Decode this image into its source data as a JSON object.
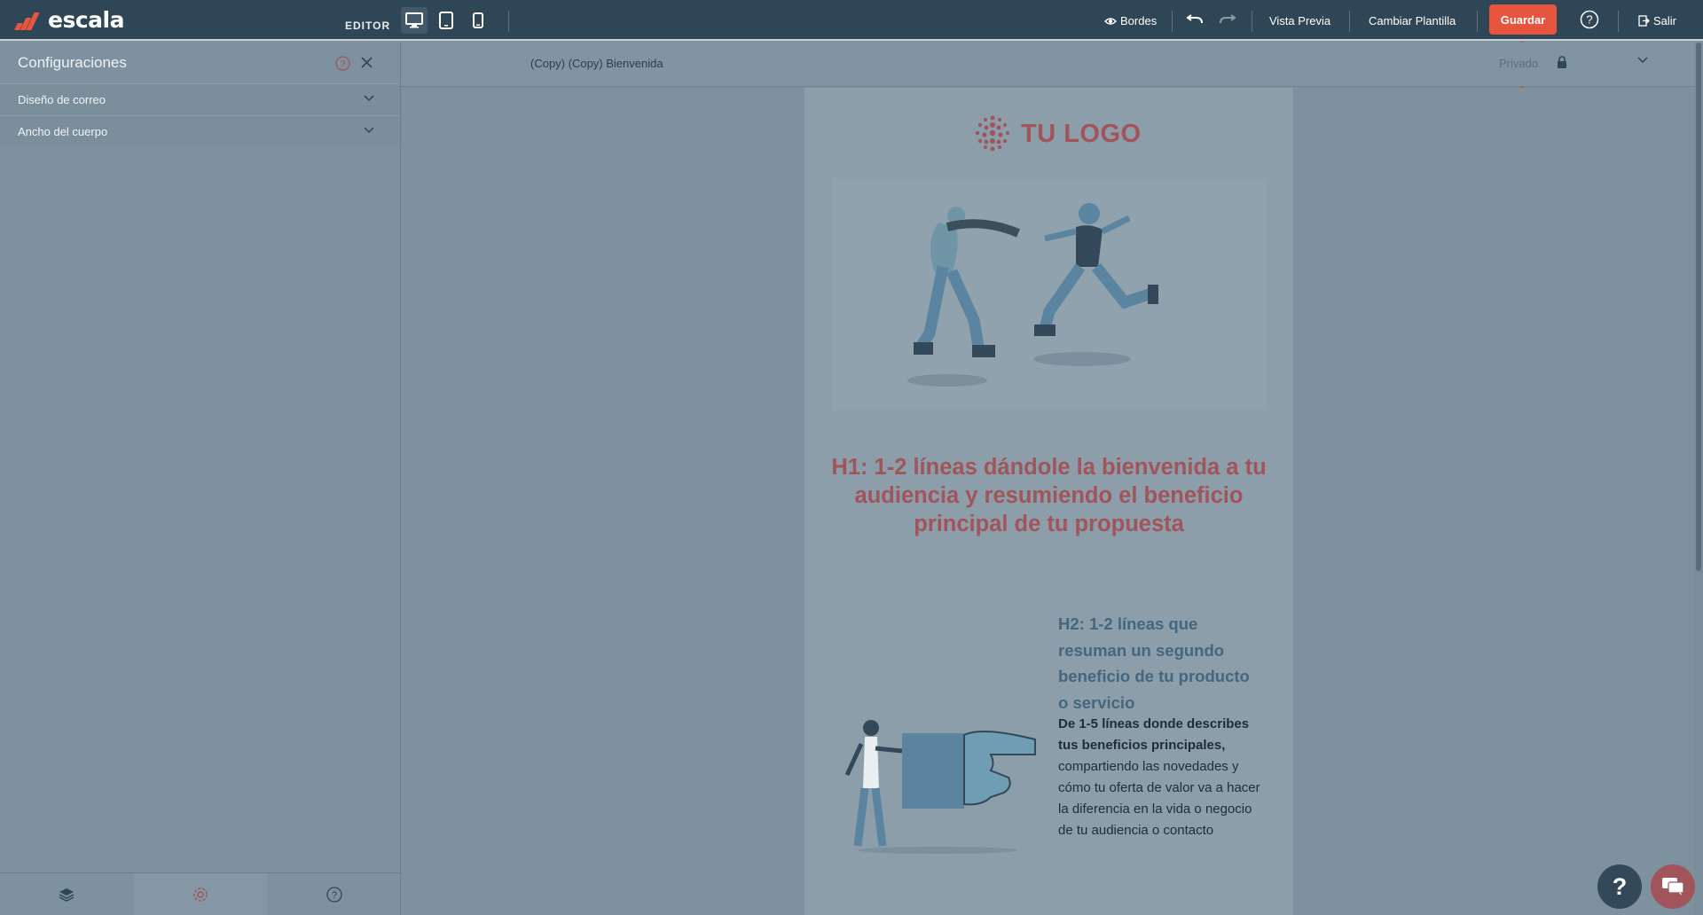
{
  "app": {
    "brand": "escala",
    "mode_label": "EDITOR"
  },
  "toolbar": {
    "devices": [
      "desktop-icon",
      "tablet-icon",
      "mobile-icon"
    ],
    "bordes_label": "Bordes",
    "vista_previa_label": "Vista Previa",
    "cambiar_plantilla_label": "Cambiar Plantilla",
    "guardar_label": "Guardar",
    "salir_label": "Salir"
  },
  "sidebar": {
    "title": "Configuraciones",
    "sections": [
      {
        "label": "Diseño de correo"
      },
      {
        "label": "Ancho del cuerpo"
      }
    ]
  },
  "canvas": {
    "template_name": "(Copy) (Copy) Bienvenida",
    "visibility_label": "Privado"
  },
  "email": {
    "logo_text": "TU LOGO",
    "h1": "H1: 1-2 líneas dándole la bienvenida a tu audiencia y resumiendo el beneficio principal de tu propuesta",
    "h2": "H2: 1-2 líneas que resuman un segundo beneficio de tu producto o servicio",
    "body_bold": "De 1-5 líneas donde describes tus beneficios principales,",
    "body_rest": " compartiendo las novedades y cómo tu oferta de valor va a hacer la diferencia en la vida o negocio de tu audiencia o contacto"
  },
  "colors": {
    "accent": "#e8553f",
    "topbar": "#2f4656",
    "overlay": "#7d919f",
    "brand_red": "#a15459"
  }
}
